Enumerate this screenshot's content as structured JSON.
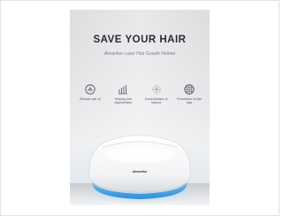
{
  "poster": {
    "headline": "SAVE YOUR HAIR",
    "subline": "Almanfun Laser Hair Growth Helmet",
    "brand_mark": "Almanfun",
    "features": [
      {
        "icon": "hair-follicle-icon",
        "caption": "Reduce hair oil"
      },
      {
        "icon": "hair-strands-icon",
        "caption": "Helping hair regeneration"
      },
      {
        "icon": "dots-burst-icon",
        "caption": "Consolidation of haircut"
      },
      {
        "icon": "grid-globe-icon",
        "caption": "Prevention of hair loss"
      }
    ],
    "accent_color": "#3aa0e6",
    "headline_color": "#2a2c31"
  }
}
